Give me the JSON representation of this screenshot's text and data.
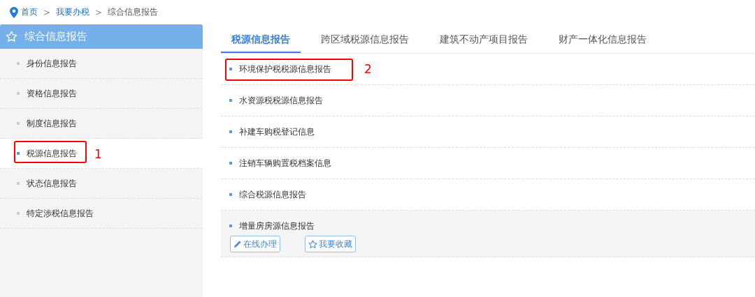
{
  "breadcrumb": [
    {
      "label": "首页",
      "kind": "link"
    },
    {
      "label": "我要办税",
      "kind": "link"
    },
    {
      "label": "综合信息报告",
      "kind": "current"
    }
  ],
  "breadcrumb_separator": ">",
  "sidebar": {
    "title": "综合信息报告",
    "items": [
      {
        "label": "身份信息报告",
        "selected": false
      },
      {
        "label": "资格信息报告",
        "selected": false
      },
      {
        "label": "制度信息报告",
        "selected": false
      },
      {
        "label": "税源信息报告",
        "selected": true,
        "annotation": "1"
      },
      {
        "label": "状态信息报告",
        "selected": false
      },
      {
        "label": "特定涉税信息报告",
        "selected": false
      }
    ]
  },
  "tabs": [
    {
      "label": "税源信息报告",
      "selected": true
    },
    {
      "label": "跨区域税源信息报告",
      "selected": false
    },
    {
      "label": "建筑不动产项目报告",
      "selected": false
    },
    {
      "label": "财产一体化信息报告",
      "selected": false
    }
  ],
  "items": [
    {
      "label": "环境保护税税源信息报告",
      "expanded": false,
      "annotation": "2"
    },
    {
      "label": "水资源税税源信息报告",
      "expanded": false
    },
    {
      "label": "补建车购税登记信息",
      "expanded": false
    },
    {
      "label": "注销车辆购置税档案信息",
      "expanded": false
    },
    {
      "label": "综合税源信息报告",
      "expanded": false
    },
    {
      "label": "增量房房源信息报告",
      "expanded": true,
      "actions": [
        {
          "label": "在线办理",
          "kind": "edit"
        },
        {
          "label": "我要收藏",
          "kind": "favorite"
        }
      ]
    }
  ]
}
